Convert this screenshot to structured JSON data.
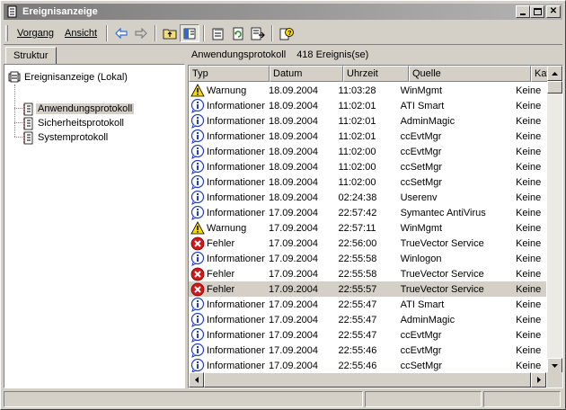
{
  "window": {
    "title": "Ereignisanzeige"
  },
  "menu": {
    "items": [
      "Vorgang",
      "Ansicht"
    ]
  },
  "toolbar": {
    "icons": [
      "back-arrow-icon",
      "forward-arrow-icon",
      "up-folder-icon",
      "show-hide-tree-icon",
      "properties-icon",
      "refresh-icon",
      "export-list-icon",
      "help-icon"
    ]
  },
  "left": {
    "tab": "Struktur",
    "tree": [
      {
        "label": "Ereignisanzeige (Lokal)"
      },
      {
        "label": "Anwendungsprotokoll",
        "selected": true
      },
      {
        "label": "Sicherheitsprotokoll"
      },
      {
        "label": "Systemprotokoll"
      }
    ]
  },
  "right": {
    "title": "Anwendungsprotokoll",
    "count": "418 Ereignis(se)",
    "columns": [
      "Typ",
      "Datum",
      "Uhrzeit",
      "Quelle",
      "Kategorie"
    ],
    "rows": [
      {
        "icon": "warning",
        "typ": "Warnung",
        "datum": "18.09.2004",
        "uhrzeit": "11:03:28",
        "quelle": "WinMgmt",
        "kat": "Keine"
      },
      {
        "icon": "info",
        "typ": "Informationen",
        "datum": "18.09.2004",
        "uhrzeit": "11:02:01",
        "quelle": "ATI Smart",
        "kat": "Keine"
      },
      {
        "icon": "info",
        "typ": "Informationen",
        "datum": "18.09.2004",
        "uhrzeit": "11:02:01",
        "quelle": "AdminMagic",
        "kat": "Keine"
      },
      {
        "icon": "info",
        "typ": "Informationen",
        "datum": "18.09.2004",
        "uhrzeit": "11:02:01",
        "quelle": "ccEvtMgr",
        "kat": "Keine"
      },
      {
        "icon": "info",
        "typ": "Informationen",
        "datum": "18.09.2004",
        "uhrzeit": "11:02:00",
        "quelle": "ccEvtMgr",
        "kat": "Keine"
      },
      {
        "icon": "info",
        "typ": "Informationen",
        "datum": "18.09.2004",
        "uhrzeit": "11:02:00",
        "quelle": "ccSetMgr",
        "kat": "Keine"
      },
      {
        "icon": "info",
        "typ": "Informationen",
        "datum": "18.09.2004",
        "uhrzeit": "11:02:00",
        "quelle": "ccSetMgr",
        "kat": "Keine"
      },
      {
        "icon": "info",
        "typ": "Informationen",
        "datum": "18.09.2004",
        "uhrzeit": "02:24:38",
        "quelle": "Userenv",
        "kat": "Keine"
      },
      {
        "icon": "info",
        "typ": "Informationen",
        "datum": "17.09.2004",
        "uhrzeit": "22:57:42",
        "quelle": "Symantec AntiVirus",
        "kat": "Keine"
      },
      {
        "icon": "warning",
        "typ": "Warnung",
        "datum": "17.09.2004",
        "uhrzeit": "22:57:11",
        "quelle": "WinMgmt",
        "kat": "Keine"
      },
      {
        "icon": "error",
        "typ": "Fehler",
        "datum": "17.09.2004",
        "uhrzeit": "22:56:00",
        "quelle": "TrueVector Service",
        "kat": "Keine"
      },
      {
        "icon": "info",
        "typ": "Informationen",
        "datum": "17.09.2004",
        "uhrzeit": "22:55:58",
        "quelle": "Winlogon",
        "kat": "Keine"
      },
      {
        "icon": "error",
        "typ": "Fehler",
        "datum": "17.09.2004",
        "uhrzeit": "22:55:58",
        "quelle": "TrueVector Service",
        "kat": "Keine"
      },
      {
        "icon": "error",
        "typ": "Fehler",
        "datum": "17.09.2004",
        "uhrzeit": "22:55:57",
        "quelle": "TrueVector Service",
        "kat": "Keine",
        "selected": true
      },
      {
        "icon": "info",
        "typ": "Informationen",
        "datum": "17.09.2004",
        "uhrzeit": "22:55:47",
        "quelle": "ATI Smart",
        "kat": "Keine"
      },
      {
        "icon": "info",
        "typ": "Informationen",
        "datum": "17.09.2004",
        "uhrzeit": "22:55:47",
        "quelle": "AdminMagic",
        "kat": "Keine"
      },
      {
        "icon": "info",
        "typ": "Informationen",
        "datum": "17.09.2004",
        "uhrzeit": "22:55:47",
        "quelle": "ccEvtMgr",
        "kat": "Keine"
      },
      {
        "icon": "info",
        "typ": "Informationen",
        "datum": "17.09.2004",
        "uhrzeit": "22:55:46",
        "quelle": "ccEvtMgr",
        "kat": "Keine"
      },
      {
        "icon": "info",
        "typ": "Informationen",
        "datum": "17.09.2004",
        "uhrzeit": "22:55:46",
        "quelle": "ccSetMgr",
        "kat": "Keine"
      }
    ]
  },
  "colors": {
    "info": "#1f3fbf",
    "warning": "#f6d800",
    "error": "#d01818",
    "selection": "#d4d0c8"
  }
}
